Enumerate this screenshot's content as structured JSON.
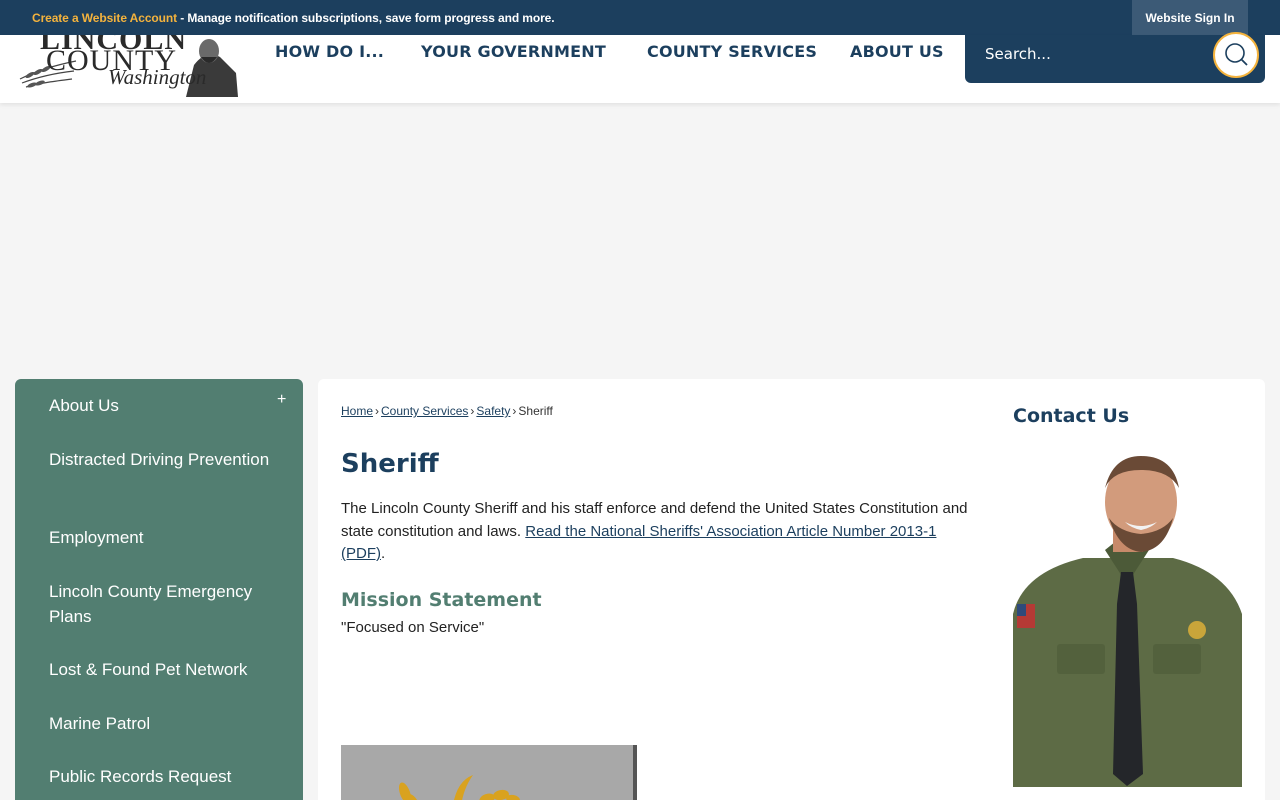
{
  "topbar": {
    "create_account_link": "Create a Website Account",
    "message": " - Manage notification subscriptions, save form progress and more.",
    "sign_in": "Website Sign In"
  },
  "logo": {
    "line1": "LINCOLN",
    "line2": "COUNTY",
    "line3": "Washington"
  },
  "nav": {
    "items": [
      "HOW DO I...",
      "YOUR GOVERNMENT",
      "COUNTY SERVICES",
      "ABOUT US"
    ]
  },
  "search": {
    "placeholder": "Search..."
  },
  "sidebar": {
    "expand_symbol": "+",
    "items": [
      "About Us",
      "Distracted Driving Prevention",
      "Employment",
      "Lincoln County Emergency Plans",
      "Lost & Found Pet Network",
      "Marine Patrol",
      "Public Records Request"
    ]
  },
  "breadcrumb": {
    "links": [
      "Home",
      "County Services",
      "Safety"
    ],
    "current": "Sheriff",
    "separator": "›"
  },
  "page": {
    "title": "Sheriff",
    "intro": "The Lincoln County Sheriff and his staff enforce and defend the United States Constitution and state constitution and laws. ",
    "intro_link": "Read the National Sheriffs' Association Article Number 2013-1 (PDF)",
    "intro_end": ".",
    "mission_heading": "Mission Statement",
    "mission_text": "\"Focused on Service\""
  },
  "contact": {
    "heading": "Contact Us"
  },
  "colors": {
    "navy": "#1c3f5e",
    "gold": "#f4b33d",
    "green": "#527e71"
  }
}
